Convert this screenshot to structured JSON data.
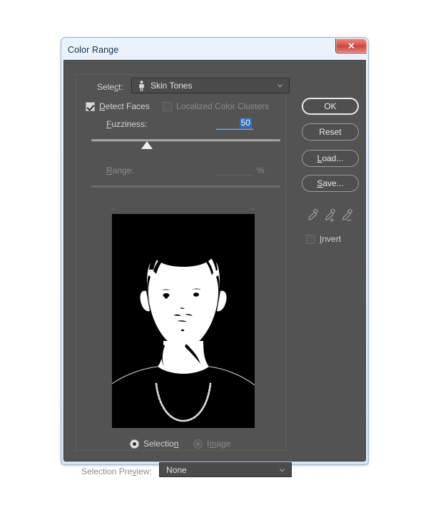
{
  "window": {
    "title": "Color Range",
    "close_icon": "close-x-icon"
  },
  "main": {
    "select_label": "Select:",
    "select_value": "Skin Tones",
    "select_icon": "person-figure-icon",
    "detect_faces_label": "Detect Faces",
    "detect_faces_checked": true,
    "localized_color_clusters_label": "Localized Color Clusters",
    "localized_color_clusters_checked": false,
    "fuzziness_label": "Fuzziness:",
    "fuzziness_value": "50",
    "range_label": "Range:",
    "range_value": "",
    "range_unit": "%",
    "preview_mode_selection_label": "Selection",
    "preview_mode_image_label": "Image",
    "preview_mode_selected": "Selection",
    "selection_preview_label": "Selection Preview:",
    "selection_preview_value": "None",
    "dropdown_icon": "chevron-down-icon"
  },
  "buttons": {
    "ok": "OK",
    "reset": "Reset",
    "load": "Load...",
    "save": "Save..."
  },
  "tools": {
    "eyedropper": "eyedropper-icon",
    "eyedropper_add": "eyedropper-plus-icon",
    "eyedropper_subtract": "eyedropper-minus-icon",
    "invert_label": "Invert",
    "invert_checked": false
  },
  "colors": {
    "panel_bg": "#535353",
    "titlebar_bg": "#dfeaf6",
    "close_red": "#cf4239",
    "highlight_blue": "#2f6fba",
    "text": "#d2d2d2",
    "text_dim": "#8c8c8c"
  }
}
